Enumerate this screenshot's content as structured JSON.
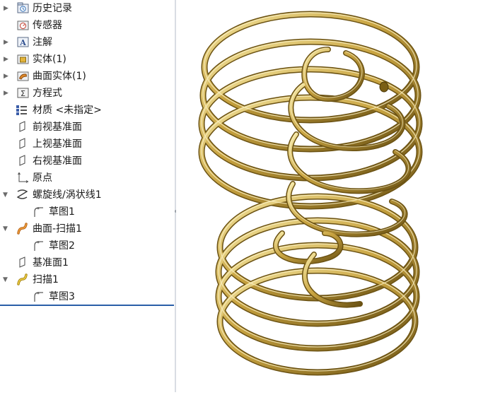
{
  "feature_tree": {
    "items": [
      {
        "label": "历史记录",
        "icon": "history-folder-icon",
        "expandable": true
      },
      {
        "label": "传感器",
        "icon": "sensor-icon",
        "expandable": false
      },
      {
        "label": "注解",
        "icon": "annotation-icon",
        "expandable": true
      },
      {
        "label": "实体(1)",
        "icon": "solid-bodies-icon",
        "expandable": true
      },
      {
        "label": "曲面实体(1)",
        "icon": "surface-bodies-icon",
        "expandable": true
      },
      {
        "label": "方程式",
        "icon": "equations-icon",
        "expandable": true
      },
      {
        "label": "材质 <未指定>",
        "icon": "material-icon",
        "expandable": false
      },
      {
        "label": "前视基准面",
        "icon": "plane-icon",
        "expandable": false
      },
      {
        "label": "上视基准面",
        "icon": "plane-icon",
        "expandable": false
      },
      {
        "label": "右视基准面",
        "icon": "plane-icon",
        "expandable": false
      },
      {
        "label": "原点",
        "icon": "origin-icon",
        "expandable": false
      },
      {
        "label": "螺旋线/涡状线1",
        "icon": "helix-icon",
        "expandable": true
      },
      {
        "label": "草图1",
        "icon": "sketch-icon",
        "expandable": false
      },
      {
        "label": "曲面-扫描1",
        "icon": "surface-sweep-icon",
        "expandable": true
      },
      {
        "label": "草图2",
        "icon": "sketch-icon",
        "expandable": false
      },
      {
        "label": "基准面1",
        "icon": "plane-icon",
        "expandable": false
      },
      {
        "label": "扫描1",
        "icon": "sweep-icon",
        "expandable": true
      },
      {
        "label": "草图3",
        "icon": "sketch-icon",
        "expandable": false
      }
    ]
  },
  "model_colors": {
    "gold_light": "#f5e7a3",
    "gold_mid": "#c9a441",
    "gold_dark": "#6b5213",
    "accent_blue": "#2a5ea8"
  }
}
